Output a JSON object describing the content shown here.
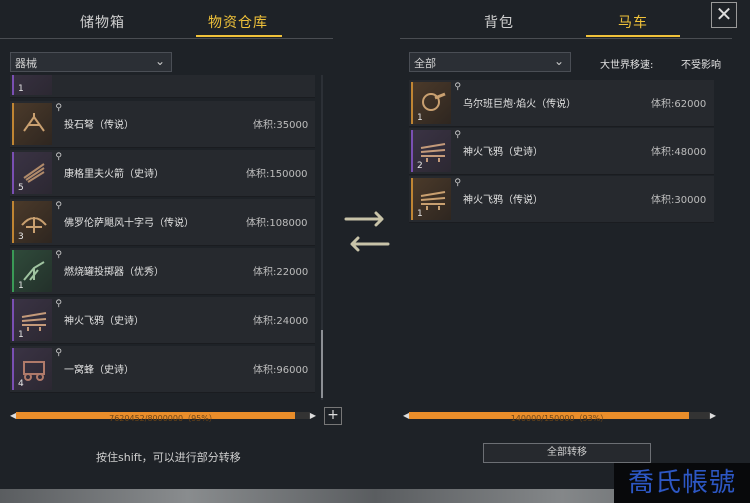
{
  "left": {
    "tabs": [
      {
        "label": "储物箱",
        "active": false
      },
      {
        "label": "物资仓库",
        "active": true
      }
    ],
    "filter": "器械",
    "items": [
      {
        "name": "",
        "volume_label": "体积:",
        "volume": "",
        "qty": "1",
        "rarity": "epic"
      },
      {
        "name": "投石弩（传说）",
        "volume_label": "体积:",
        "volume": "35000",
        "qty": "",
        "rarity": "legendary"
      },
      {
        "name": "康格里夫火箭（史诗）",
        "volume_label": "体积:",
        "volume": "150000",
        "qty": "5",
        "rarity": "epic"
      },
      {
        "name": "佛罗伦萨飓风十字弓（传说）",
        "volume_label": "体积:",
        "volume": "108000",
        "qty": "3",
        "rarity": "legendary"
      },
      {
        "name": "燃烧罐投掷器（优秀）",
        "volume_label": "体积:",
        "volume": "22000",
        "qty": "1",
        "rarity": "fine"
      },
      {
        "name": "神火飞鸦（史诗）",
        "volume_label": "体积:",
        "volume": "24000",
        "qty": "1",
        "rarity": "epic"
      },
      {
        "name": "一窝蜂（史诗）",
        "volume_label": "体积:",
        "volume": "96000",
        "qty": "4",
        "rarity": "epic"
      }
    ],
    "capacity": {
      "text": "7620452/8000000（95%）",
      "fraction": 0.95
    },
    "hint": "按住shift，可以进行部分转移"
  },
  "right": {
    "tabs": [
      {
        "label": "背包",
        "active": false
      },
      {
        "label": "马车",
        "active": true
      }
    ],
    "filter": "全部",
    "speed_label": "大世界移速:",
    "speed_value": "不受影响",
    "items": [
      {
        "name": "乌尔班巨炮·焰火（传说）",
        "volume_label": "体积:",
        "volume": "62000",
        "qty": "1",
        "rarity": "legendary"
      },
      {
        "name": "神火飞鸦（史诗）",
        "volume_label": "体积:",
        "volume": "48000",
        "qty": "2",
        "rarity": "epic"
      },
      {
        "name": "神火飞鸦（传说）",
        "volume_label": "体积:",
        "volume": "30000",
        "qty": "1",
        "rarity": "legendary"
      }
    ],
    "capacity": {
      "text": "140000/150000（93%）",
      "fraction": 0.93
    },
    "transfer_all": "全部转移"
  },
  "close_icon": "close-icon",
  "watermark": "喬氏帳號",
  "colors": {
    "accent": "#f0c23a",
    "capacity": "#e98d2a",
    "epic": "#7a4fb3",
    "legendary": "#c08533",
    "fine": "#3a9a56"
  }
}
